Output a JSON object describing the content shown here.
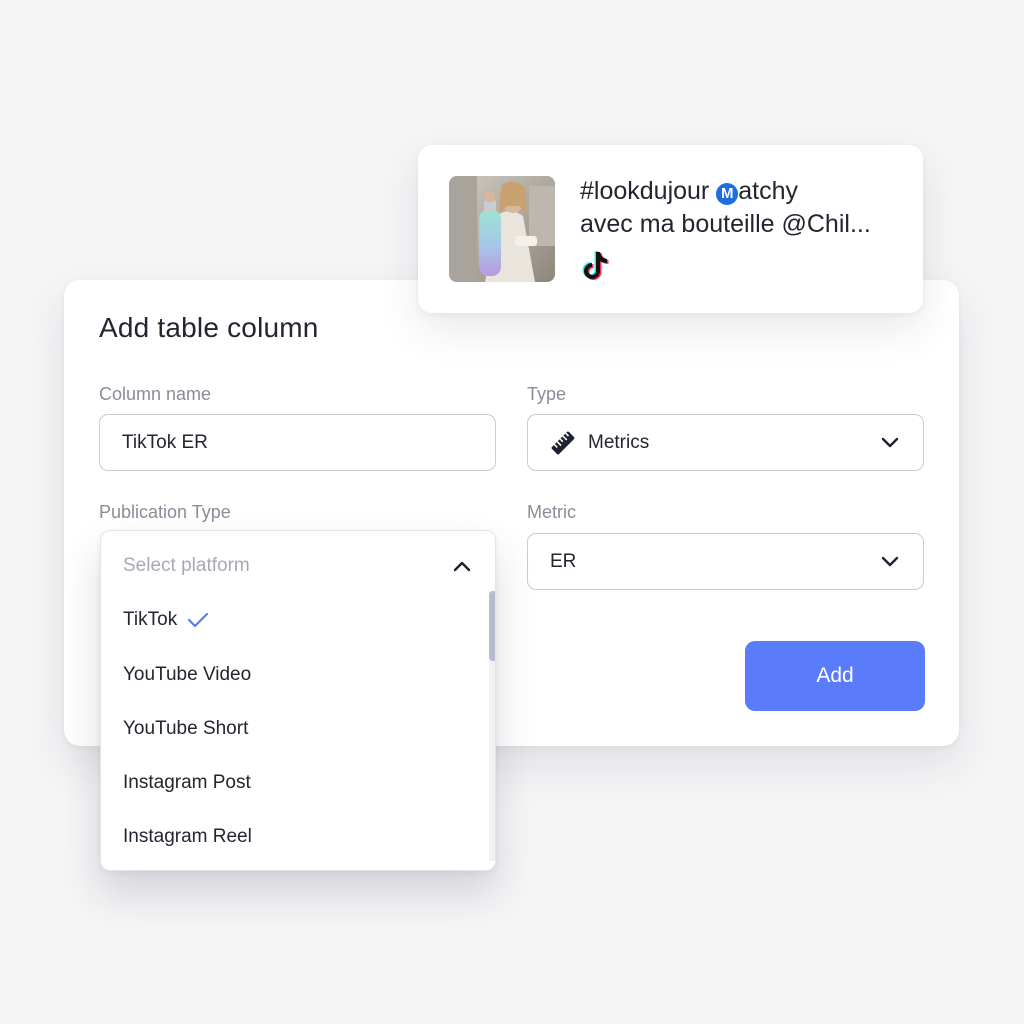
{
  "post": {
    "hashtag": "#lookdujour",
    "badge_letter": "M",
    "title_rest": "atchy",
    "line2": "avec ma bouteille @Chil...",
    "platform_icon": "tiktok-icon",
    "thumbnail": "person-holding-gradient-bottle"
  },
  "dialog": {
    "title": "Add table column",
    "column_name": {
      "label": "Column name",
      "value": "TikTok ER"
    },
    "type": {
      "label": "Type",
      "value": "Metrics",
      "icon": "ruler-icon"
    },
    "publication_type": {
      "label": "Publication Type",
      "placeholder": "Select platform",
      "options": [
        {
          "label": "TikTok",
          "selected": true
        },
        {
          "label": "YouTube Video",
          "selected": false
        },
        {
          "label": "YouTube Short",
          "selected": false
        },
        {
          "label": "Instagram Post",
          "selected": false
        },
        {
          "label": "Instagram Reel",
          "selected": false
        }
      ]
    },
    "metric": {
      "label": "Metric",
      "value": "ER"
    },
    "add_label": "Add"
  },
  "colors": {
    "accent": "#5b7cfa",
    "check": "#5b7cfa",
    "badge": "#1f6de0",
    "background": "#f5f5f6"
  }
}
